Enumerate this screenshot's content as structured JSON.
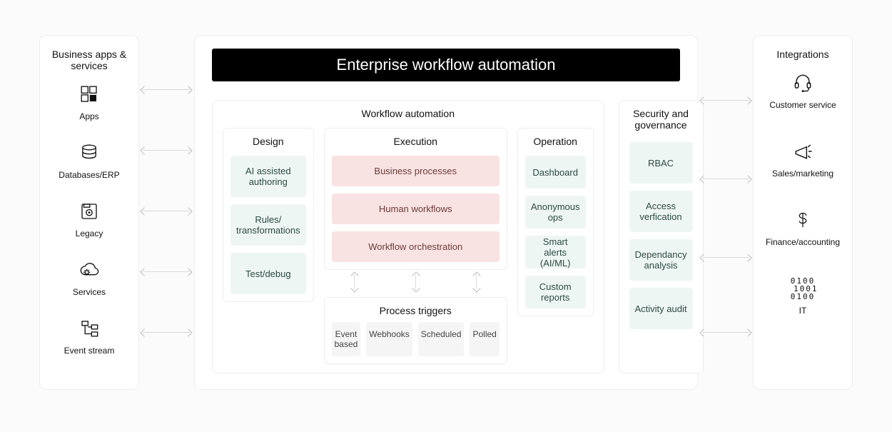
{
  "left_panel": {
    "title": "Business apps & services",
    "items": [
      {
        "label": "Apps"
      },
      {
        "label": "Databases/ERP"
      },
      {
        "label": "Legacy"
      },
      {
        "label": "Services"
      },
      {
        "label": "Event stream"
      }
    ]
  },
  "main": {
    "banner": "Enterprise workflow automation",
    "workflow_title": "Workflow automation",
    "design": {
      "title": "Design",
      "items": [
        "AI assisted authoring",
        "Rules/\ntransformations",
        "Test/debug"
      ]
    },
    "execution": {
      "title": "Execution",
      "items": [
        "Business processes",
        "Human workflows",
        "Workflow orchestration"
      ],
      "process_triggers": {
        "title": "Process triggers",
        "items": [
          "Event based",
          "Webhooks",
          "Scheduled",
          "Polled"
        ]
      }
    },
    "operation": {
      "title": "Operation",
      "items": [
        "Dashboard",
        "Anonymous ops",
        "Smart alerts (AI/ML)",
        "Custom reports"
      ]
    },
    "security": {
      "title": "Security and governance",
      "items": [
        "RBAC",
        "Access verfication",
        "Dependancy analysis",
        "Activity audit"
      ]
    }
  },
  "right_panel": {
    "title": "Integrations",
    "items": [
      {
        "label": "Customer service"
      },
      {
        "label": "Sales/marketing"
      },
      {
        "label": "Finance/accounting"
      },
      {
        "label": "IT"
      }
    ]
  }
}
